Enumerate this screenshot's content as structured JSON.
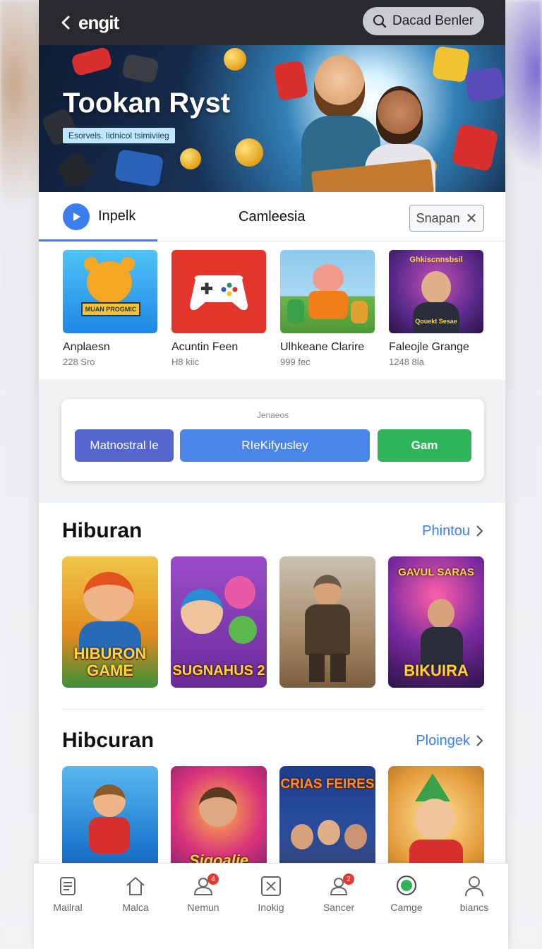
{
  "header": {
    "app_title": "engit",
    "search_label": "Dacad Benler"
  },
  "hero": {
    "title": "Tookan Ryst",
    "badge": "Esorvels. Iidnicol tsimiviieg"
  },
  "tabs": {
    "active_label": "Inpelk",
    "middle_label": "Camleesia",
    "chip_label": "Snapan"
  },
  "featured": [
    {
      "name": "Anplaesn",
      "sub": "228 Sro",
      "art": "MUAN PROGMIC",
      "color": "#35a8e6"
    },
    {
      "name": "Acuntin Feen",
      "sub": "H8 kiic",
      "art": "",
      "color": "#e2362c"
    },
    {
      "name": "Ulhkeane Clarire",
      "sub": "999 fec",
      "art": "",
      "color": "#6aa9d8"
    },
    {
      "name": "Faleojle Grange",
      "sub": "1248 8la",
      "art": "Ghkiscnnsbsil",
      "art2": "Qouekt Sesae",
      "color": "#6b2a8a"
    }
  ],
  "filter_panel": {
    "caption": "Jenaeos",
    "buttons": [
      {
        "label": "Matnostral le",
        "color": "#5567cf"
      },
      {
        "label": "RIeKifyusley",
        "color": "#4a86ea"
      },
      {
        "label": "Gam",
        "color": "#2fb45a"
      }
    ]
  },
  "sections": [
    {
      "title": "Hiburan",
      "link": "Phintou",
      "cards": [
        {
          "art": "HIBURON GAME",
          "bg": "#e6a12e"
        },
        {
          "art": "SUGNAHUS 2",
          "bg": "#8a3fb5"
        },
        {
          "art": "",
          "bg": "#8d7256"
        },
        {
          "art": "BIKUIRA",
          "art_top": "GAVUL SARAS",
          "bg": "#5a2c7a"
        }
      ]
    },
    {
      "title": "Hibcuran",
      "link": "Ploingek",
      "cards": [
        {
          "art": "",
          "bg": "#2a8bd6"
        },
        {
          "art": "Sigoalie",
          "bg": "#b8327a"
        },
        {
          "art": "CRIAS FEIRES",
          "bg": "#243e8c"
        },
        {
          "art": "",
          "bg": "#e39b3a"
        }
      ]
    }
  ],
  "bottom_nav": [
    {
      "label": "Mailral",
      "icon": "document-icon",
      "badge": ""
    },
    {
      "label": "Malca",
      "icon": "home-icon",
      "badge": ""
    },
    {
      "label": "Nemun",
      "icon": "people-icon",
      "badge": "4"
    },
    {
      "label": "Inokig",
      "icon": "close-box-icon",
      "badge": ""
    },
    {
      "label": "Sancer",
      "icon": "user-icon",
      "badge": "2"
    },
    {
      "label": "Camge",
      "icon": "location-pin-icon",
      "badge": ""
    },
    {
      "label": "biancs",
      "icon": "profile-icon",
      "badge": ""
    }
  ]
}
